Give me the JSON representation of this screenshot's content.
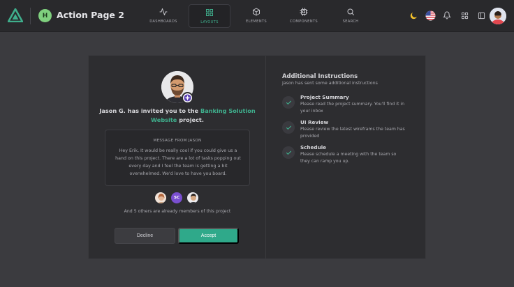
{
  "header": {
    "page_avatar_initial": "H",
    "page_title": "Action Page 2",
    "nav": [
      {
        "label": "DASHBOARDS",
        "icon": "activity-icon"
      },
      {
        "label": "LAYOUTS",
        "icon": "grid-icon",
        "active": true
      },
      {
        "label": "ELEMENTS",
        "icon": "box-icon"
      },
      {
        "label": "COMPONENTS",
        "icon": "cpu-icon"
      },
      {
        "label": "SEARCH",
        "icon": "search-icon"
      }
    ],
    "right_icons": [
      "moon-icon",
      "us-flag-icon",
      "bell-icon",
      "apps-grid-icon",
      "sidebar-toggle-icon",
      "user-avatar"
    ]
  },
  "invite": {
    "prefix": "Jason G. has invited you to the ",
    "project_name": "Banking Solution Website",
    "suffix": " project.",
    "message_title": "MESSAGE FROM JASON",
    "message_body": "Hey Erik, It would be really cool if you could give us a hand on this project. There are a lot of tasks popping out every day and I feel the team is getting a bit overwhelmed. We'd love to have you board.",
    "member_initials": "SC",
    "others_text": "And 5 others are already members of this project",
    "decline_label": "Decline",
    "accept_label": "Accept"
  },
  "instructions": {
    "title": "Additional Instructions",
    "subtitle": "Jason has sent some additional instructions",
    "steps": [
      {
        "title": "Project Summary",
        "desc": "Please read the project summary. You'll find it in your inbox"
      },
      {
        "title": "UI Review",
        "desc": "Please review the latest wireframs the team has provided"
      },
      {
        "title": "Schedule",
        "desc": "Please schedule a meeting with the team so they can ramp you up."
      }
    ]
  },
  "colors": {
    "accent": "#2fa98a",
    "background": "#3b3b3f",
    "card": "#2d2d30",
    "topbar": "#29292c"
  }
}
